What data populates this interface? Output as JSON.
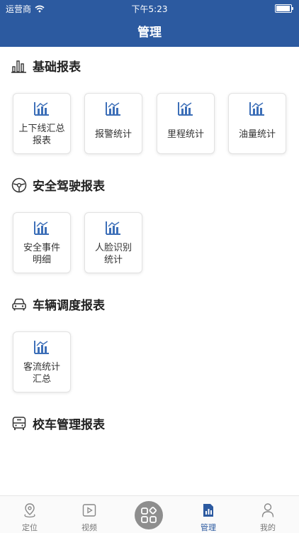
{
  "status_bar": {
    "carrier": "运营商",
    "time": "下午5:23"
  },
  "header": {
    "title": "管理"
  },
  "sections": [
    {
      "title": "基础报表",
      "icon": "bar-chart-icon",
      "items": [
        {
          "line1": "上下线汇总",
          "line2": "报表"
        },
        {
          "line1": "报警统计",
          "line2": ""
        },
        {
          "line1": "里程统计",
          "line2": ""
        },
        {
          "line1": "油量统计",
          "line2": ""
        }
      ]
    },
    {
      "title": "安全驾驶报表",
      "icon": "steering-wheel-icon",
      "items": [
        {
          "line1": "安全事件",
          "line2": "明细"
        },
        {
          "line1": "人脸识别",
          "line2": "统计"
        }
      ]
    },
    {
      "title": "车辆调度报表",
      "icon": "car-icon",
      "items": [
        {
          "line1": "客流统计",
          "line2": "汇总"
        }
      ]
    },
    {
      "title": "校车管理报表",
      "icon": "bus-icon",
      "items": []
    }
  ],
  "tabbar": {
    "tabs": [
      {
        "label": "定位",
        "icon": "location-icon",
        "active": false
      },
      {
        "label": "视频",
        "icon": "video-icon",
        "active": false
      },
      {
        "label": "管理",
        "icon": "report-icon",
        "active": true
      },
      {
        "label": "我的",
        "icon": "user-icon",
        "active": false
      }
    ],
    "center_icon": "apps-grid-icon"
  },
  "colors": {
    "primary": "#2c5aa0",
    "icon_blue": "#3d6fb8",
    "text": "#222222"
  }
}
